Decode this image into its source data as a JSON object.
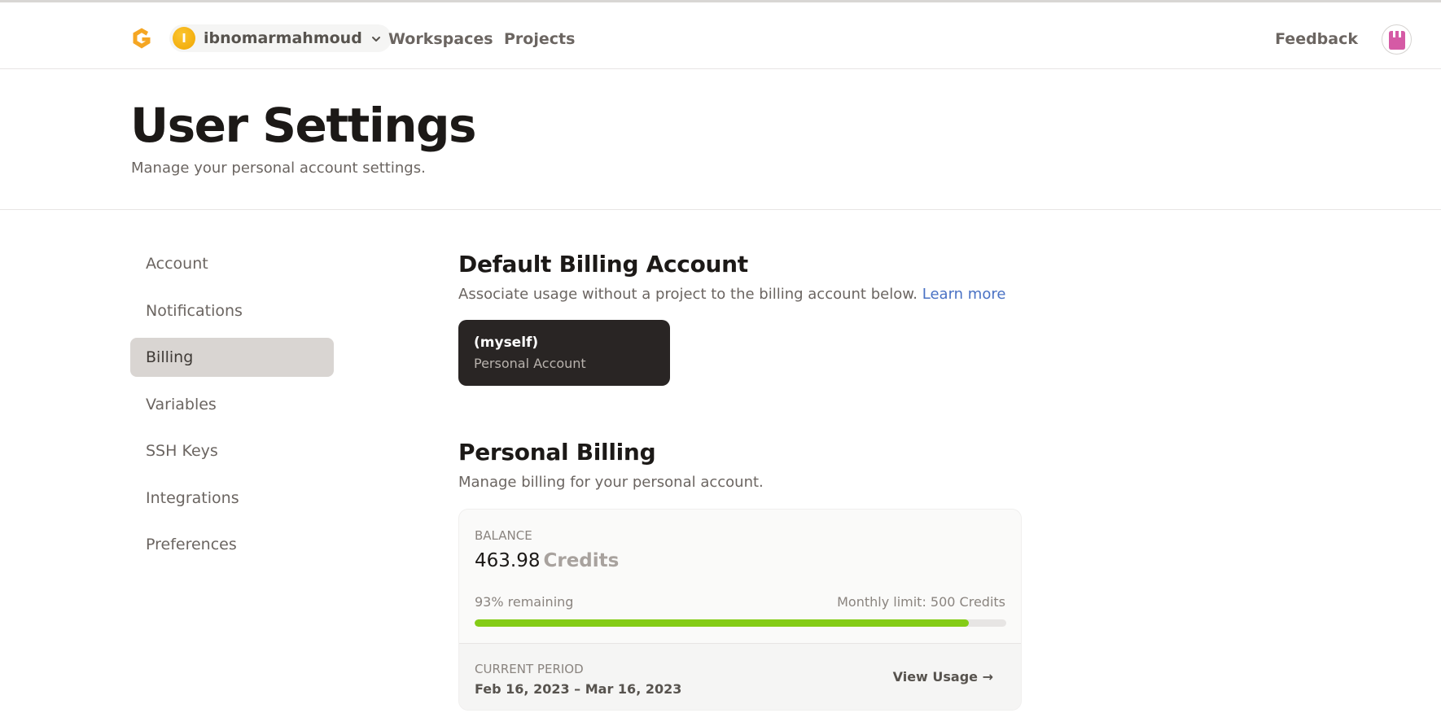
{
  "header": {
    "user_initial": "I",
    "username": "ibnomarmahmoud",
    "nav": [
      "Workspaces",
      "Projects"
    ],
    "feedback": "Feedback",
    "logo_color": "#f5a623",
    "avatar_color": "#d55aa5"
  },
  "page": {
    "title": "User Settings",
    "subtitle": "Manage your personal account settings."
  },
  "sidebar": {
    "items": [
      {
        "label": "Account"
      },
      {
        "label": "Notifications"
      },
      {
        "label": "Billing",
        "active": true
      },
      {
        "label": "Variables"
      },
      {
        "label": "SSH Keys"
      },
      {
        "label": "Integrations"
      },
      {
        "label": "Preferences"
      }
    ]
  },
  "default_billing": {
    "title": "Default Billing Account",
    "description": "Associate usage without a project to the billing account below.",
    "learn_more": "Learn more",
    "account_name": "(myself)",
    "account_type": "Personal Account"
  },
  "personal_billing": {
    "title": "Personal Billing",
    "description": "Manage billing for your personal account.",
    "balance_label": "BALANCE",
    "balance_value": "463.98",
    "balance_unit": "Credits",
    "remaining": "93% remaining",
    "remaining_fraction": 0.93,
    "monthly_limit": "Monthly limit: 500 Credits",
    "period_label": "CURRENT PERIOD",
    "period_value": "Feb 16, 2023 – Mar 16, 2023",
    "view_usage": "View Usage →",
    "progress_color": "#84cc16"
  }
}
